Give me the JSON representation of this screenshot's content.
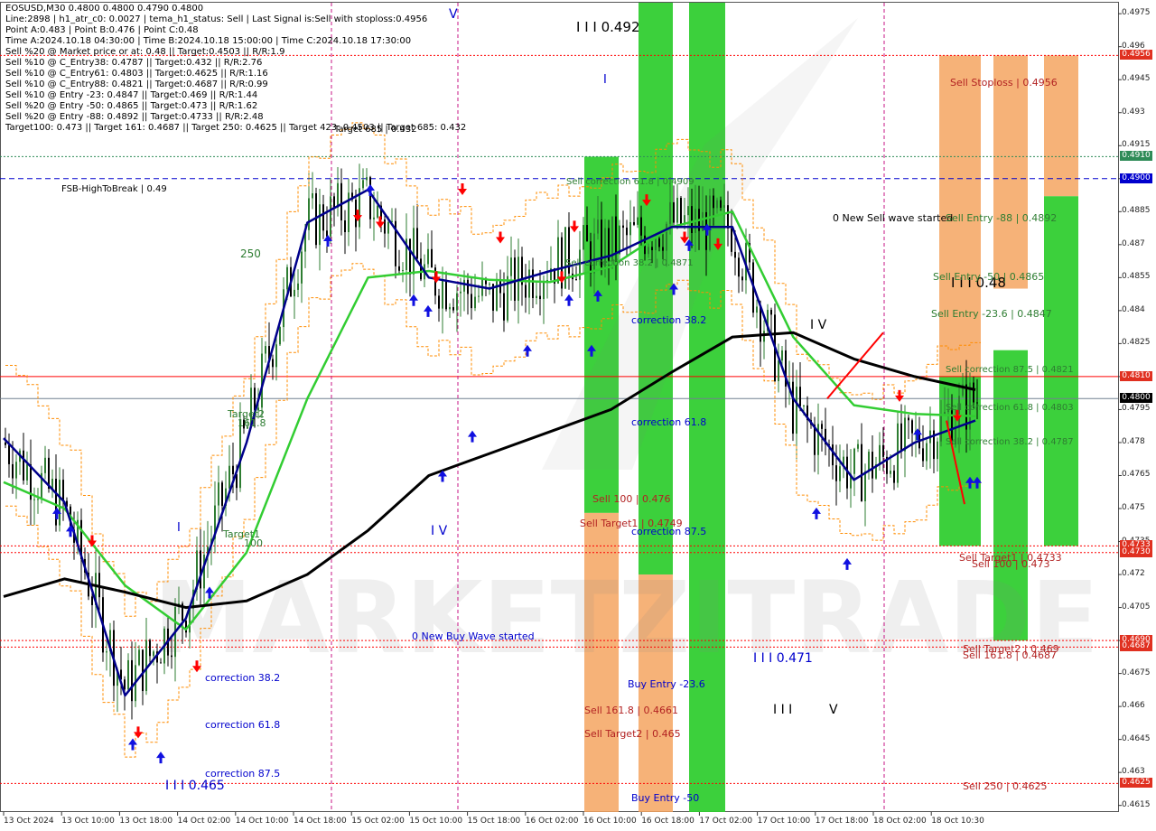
{
  "header": {
    "lines": [
      "EOSUSD,M30  0.4800 0.4800 0.4790 0.4800",
      "Line:2898 | h1_atr_c0: 0.0027 | tema_h1_status: Sell | Last Signal is:Sell with stoploss:0.4956",
      "Point A:0.483 | Point B:0.476 | Point C:0.48",
      "Time A:2024.10.18 04:30:00 | Time B:2024.10.18 15:00:00 | Time C:2024.10.18 17:30:00",
      "Sell %20 @ Market price or at: 0.48 || Target:0.4503 || R/R:1.9",
      "Sell %10 @ C_Entry38: 0.4787 || Target:0.432 || R/R:2.76",
      "Sell %10 @ C_Entry61: 0.4803 || Target:0.4625 || R/R:1.16",
      "Sell %10 @ C_Entry88: 0.4821 || Target:0.4687 || R/R:0.99",
      "Sell %10 @ Entry -23: 0.4847 || Target:0.469 || R/R:1.44",
      "Sell %20 @ Entry -50: 0.4865 || Target:0.473 || R/R:1.62",
      "Sell %20 @ Entry -88: 0.4892 || Target:0.4733 || R/R:2.48",
      "Target100: 0.473 || Target 161: 0.4687 || Target 250: 0.4625 || Target 423: 0.4503 || Target 685: 0.432"
    ]
  },
  "colors": {
    "background": "#ffffff",
    "bull_candle": "#2e7d32",
    "bear_candle": "#000000",
    "ema_black": "#000000",
    "ema_green": "#32cd32",
    "tema_navy": "#00008b",
    "stoploss_red": "#ff0000",
    "zone_green": "#32cd32",
    "zone_orange": "#f4a460",
    "label_blue": "#0000cd",
    "label_brown": "#b22222",
    "label_green": "#2e7d32",
    "current_price_box": "#000000",
    "red_price_box": "#e03020",
    "green_price_box": "#2e8b57",
    "blue_price_box": "#0000cd"
  },
  "watermark": "MARKETZITRADE",
  "chart_data": {
    "type": "candlestick",
    "symbol": "EOSUSD",
    "timeframe": "M30",
    "ylim": [
      0.4612,
      0.498
    ],
    "y_ticks": [
      0.4975,
      0.496,
      0.4945,
      0.493,
      0.4915,
      0.49,
      0.4885,
      0.487,
      0.4855,
      0.484,
      0.4825,
      0.481,
      0.4795,
      0.478,
      0.4765,
      0.475,
      0.4735,
      0.472,
      0.4705,
      0.469,
      0.4675,
      0.466,
      0.4645,
      0.463,
      0.4615
    ],
    "x_tick_labels": [
      "13 Oct 2024",
      "13 Oct 10:00",
      "13 Oct 18:00",
      "14 Oct 02:00",
      "14 Oct 10:00",
      "14 Oct 18:00",
      "15 Oct 02:00",
      "15 Oct 10:00",
      "15 Oct 18:00",
      "16 Oct 02:00",
      "16 Oct 10:00",
      "16 Oct 18:00",
      "17 Oct 02:00",
      "17 Oct 10:00",
      "17 Oct 18:00",
      "18 Oct 02:00",
      "18 Oct 10:30"
    ],
    "price_axis_markers": [
      {
        "value": "0.4956",
        "kind": "red"
      },
      {
        "value": "0.4910",
        "kind": "green"
      },
      {
        "value": "0.4900",
        "kind": "blue"
      },
      {
        "value": "0.4810",
        "kind": "red"
      },
      {
        "value": "0.4800",
        "kind": "current"
      },
      {
        "value": "0.4733",
        "kind": "red"
      },
      {
        "value": "0.4730",
        "kind": "red"
      },
      {
        "value": "0.4690",
        "kind": "red"
      },
      {
        "value": "0.4687",
        "kind": "red"
      },
      {
        "value": "0.4625",
        "kind": "red"
      }
    ],
    "horizontal_levels": [
      {
        "value": 0.4956,
        "style": "dotted",
        "color": "#ff0000"
      },
      {
        "value": 0.491,
        "style": "dotted",
        "color": "#2e8b57"
      },
      {
        "value": 0.49,
        "style": "dashed",
        "color": "#0000cd"
      },
      {
        "value": 0.481,
        "style": "solid",
        "color": "#ff0000"
      },
      {
        "value": 0.48,
        "style": "solid",
        "color": "#708090"
      },
      {
        "value": 0.4733,
        "style": "dotted",
        "color": "#ff0000"
      },
      {
        "value": 0.473,
        "style": "dotted",
        "color": "#ff0000"
      },
      {
        "value": 0.469,
        "style": "dotted",
        "color": "#ff0000"
      },
      {
        "value": 0.4687,
        "style": "dotted",
        "color": "#ff0000"
      },
      {
        "value": 0.4625,
        "style": "dotted",
        "color": "#ff0000"
      }
    ],
    "annotations": [
      {
        "text": "I I I 0.492",
        "color": "#000000"
      },
      {
        "text": "I I I 0.48",
        "color": "#000000"
      },
      {
        "text": "I I I 0.471",
        "color": "#0000cd"
      },
      {
        "text": "I I I 0.465",
        "color": "#0000cd"
      },
      {
        "text": "I V",
        "color": "#0000cd"
      },
      {
        "text": "I V",
        "color": "#000000"
      },
      {
        "text": "V",
        "color": "#0000cd"
      },
      {
        "text": "V",
        "color": "#000000"
      },
      {
        "text": "I",
        "color": "#0000cd"
      },
      {
        "text": "I",
        "color": "#0000cd"
      },
      {
        "text": "I I I",
        "color": "#000000"
      },
      {
        "text": "FSB-HighToBreak | 0.49",
        "color": "#000000"
      },
      {
        "text": "0 New Sell wave started",
        "color": "#000000"
      },
      {
        "text": "0 New Buy Wave started",
        "color": "#0000cd"
      },
      {
        "text": "Sell Stoploss | 0.4956",
        "color": "#b22222"
      },
      {
        "text": "Sell Entry -88 | 0.4892",
        "color": "#2e7d32"
      },
      {
        "text": "Sell Entry -50 | 0.4865",
        "color": "#2e7d32"
      },
      {
        "text": "Sell Entry -23.6 | 0.4847",
        "color": "#2e7d32"
      },
      {
        "text": "Sell correction 87.5 | 0.4821",
        "color": "#2e7d32"
      },
      {
        "text": "Sell correction 61.8 | 0.4803",
        "color": "#2e7d32"
      },
      {
        "text": "Sell correction 38.2 | 0.4787",
        "color": "#2e7d32"
      },
      {
        "text": "Sell Target1 | 0.4733",
        "color": "#b22222"
      },
      {
        "text": "Sell 100 | 0.473",
        "color": "#b22222"
      },
      {
        "text": "Sell Target2 | 0.469",
        "color": "#b22222"
      },
      {
        "text": "Sell 161.8 | 0.4687",
        "color": "#b22222"
      },
      {
        "text": "Sell 250 | 0.4625",
        "color": "#b22222"
      },
      {
        "text": "Sell correction 61.8 | 0.4909",
        "color": "#2e7d32"
      },
      {
        "text": "Sell correction 38.2 | 0.4871",
        "color": "#2e7d32"
      },
      {
        "text": "correction 38.2",
        "color": "#0000cd"
      },
      {
        "text": "correction 61.8",
        "color": "#0000cd"
      },
      {
        "text": "correction 87.5",
        "color": "#0000cd"
      },
      {
        "text": "Sell 100 | 0.476",
        "color": "#b22222"
      },
      {
        "text": "Sell Target1 | 0.4749",
        "color": "#b22222"
      },
      {
        "text": "Sell 161.8 | 0.4661",
        "color": "#b22222"
      },
      {
        "text": "Sell Target2 | 0.465",
        "color": "#b22222"
      },
      {
        "text": "Buy Entry -23.6",
        "color": "#0000cd"
      },
      {
        "text": "Buy Entry -50",
        "color": "#0000cd"
      },
      {
        "text": "correction 38.2",
        "color": "#0000cd"
      },
      {
        "text": "correction 61.8",
        "color": "#0000cd"
      },
      {
        "text": "correction 87.5",
        "color": "#0000cd"
      },
      {
        "text": "250",
        "color": "#2e7d32"
      },
      {
        "text": "Target2",
        "color": "#2e7d32"
      },
      {
        "text": "161.8",
        "color": "#2e7d32"
      },
      {
        "text": "Target1",
        "color": "#2e7d32"
      },
      {
        "text": "100",
        "color": "#2e7d32"
      },
      {
        "text": "Target 685 | 0.432",
        "color": "#000000"
      }
    ],
    "ema_black": [
      0.471,
      0.4718,
      0.4712,
      0.4705,
      0.4708,
      0.472,
      0.474,
      0.4765,
      0.4775,
      0.4785,
      0.4795,
      0.4812,
      0.4828,
      0.483,
      0.4818,
      0.481,
      0.4804
    ],
    "ema_green": [
      0.4762,
      0.475,
      0.4715,
      0.4695,
      0.473,
      0.48,
      0.4855,
      0.4858,
      0.4854,
      0.4853,
      0.486,
      0.4878,
      0.4885,
      0.4828,
      0.4797,
      0.4793,
      0.4792
    ],
    "tema_navy": [
      0.4782,
      0.4753,
      0.4665,
      0.47,
      0.478,
      0.488,
      0.4895,
      0.4855,
      0.485,
      0.4858,
      0.4865,
      0.4878,
      0.4878,
      0.48,
      0.4763,
      0.478,
      0.479
    ],
    "closes": [
      0.478,
      0.475,
      0.4668,
      0.4705,
      0.4785,
      0.488,
      0.489,
      0.4855,
      0.4845,
      0.4862,
      0.487,
      0.488,
      0.4878,
      0.4795,
      0.4765,
      0.478,
      0.48
    ],
    "zones": [
      {
        "kind": "green",
        "from": 0.4748,
        "to": 0.491
      },
      {
        "kind": "green",
        "from": 0.472,
        "to": 0.498
      },
      {
        "kind": "green",
        "from": 0.4612,
        "to": 0.498
      },
      {
        "kind": "orange",
        "from": 0.4612,
        "to": 0.4748
      },
      {
        "kind": "orange",
        "from": 0.4612,
        "to": 0.472
      },
      {
        "kind": "orange",
        "from": 0.481,
        "to": 0.4956
      },
      {
        "kind": "green",
        "from": 0.4733,
        "to": 0.481
      },
      {
        "kind": "orange",
        "from": 0.485,
        "to": 0.4956
      },
      {
        "kind": "green",
        "from": 0.469,
        "to": 0.4822
      },
      {
        "kind": "orange",
        "from": 0.4892,
        "to": 0.4956
      },
      {
        "kind": "green",
        "from": 0.4733,
        "to": 0.4892
      }
    ]
  }
}
